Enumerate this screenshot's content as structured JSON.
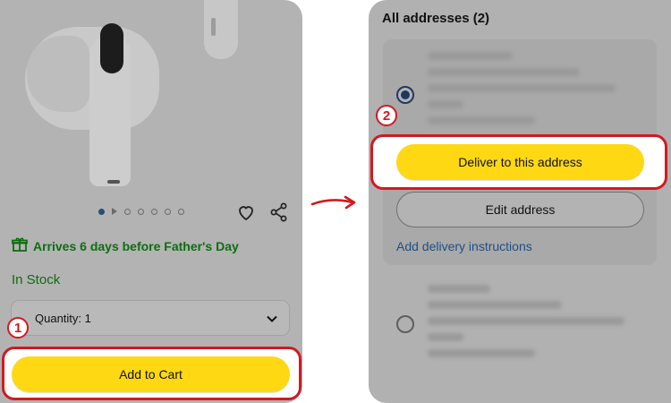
{
  "left": {
    "delivery_message": "Arrives 6 days before Father's Day",
    "stock_status": "In Stock",
    "quantity_label": "Quantity:",
    "quantity_value": "1",
    "add_to_cart_label": "Add to Cart",
    "step_number": "1",
    "image_dot_count": 7,
    "active_dot_index": 0
  },
  "right": {
    "section_title": "All addresses (2)",
    "deliver_label": "Deliver to this address",
    "edit_label": "Edit address",
    "instructions_link": "Add delivery instructions",
    "step_number": "2"
  },
  "colors": {
    "accent_yellow": "#ffd814",
    "highlight_red": "#d31920",
    "instock_green": "#0e6c12",
    "link_blue": "#1d4f86"
  }
}
